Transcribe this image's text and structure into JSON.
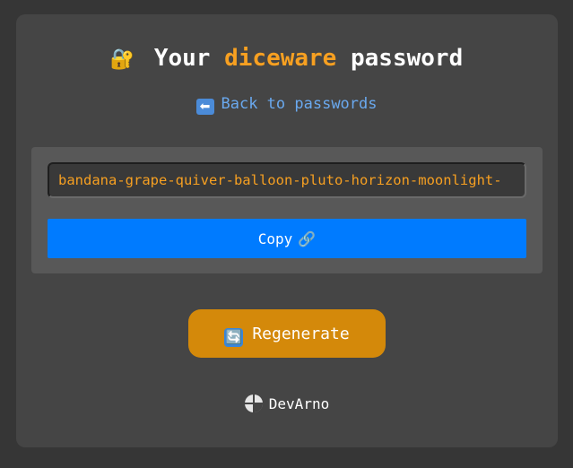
{
  "heading": {
    "icon": "🔐",
    "prefix": "Your",
    "accent": "diceware",
    "suffix": "password"
  },
  "back_link": {
    "icon": "⬅",
    "label": "Back to passwords"
  },
  "password": {
    "value": "bandana-grape-quiver-balloon-pluto-horizon-moonlight-"
  },
  "copy_button": {
    "label": "Copy",
    "icon": "🔗"
  },
  "regenerate_button": {
    "icon": "🔄",
    "label": "Regenerate"
  },
  "footer": {
    "logo_icon": "devarno-logo-icon",
    "brand": "DevArno"
  },
  "colors": {
    "accent": "#f7a021",
    "link": "#6aa9ef",
    "copy_button": "#007bff",
    "regenerate_button": "#d4890a"
  }
}
